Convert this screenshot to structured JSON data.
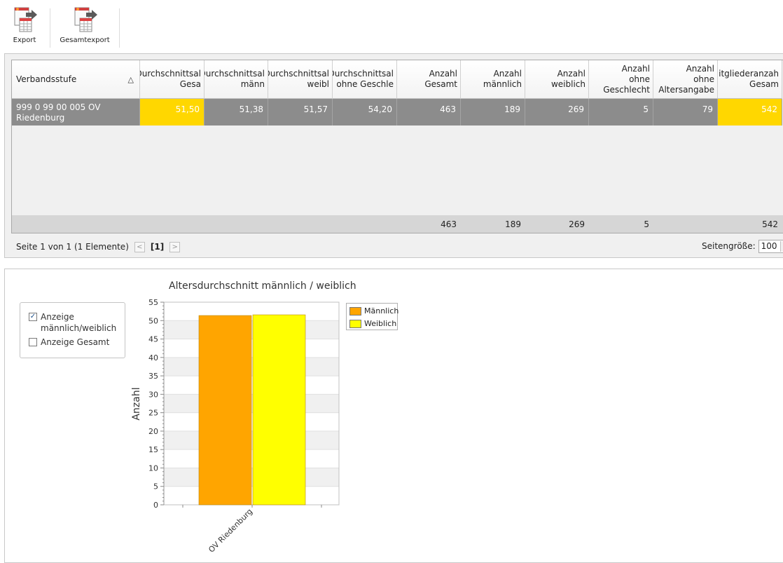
{
  "toolbar": {
    "export_label": "Export",
    "gesamtexport_label": "Gesamtexport"
  },
  "grid": {
    "columns": [
      "Verbandsstufe",
      "Durchschnittsal\nGesa",
      "Durchschnittsal\nmänn",
      "Durchschnittsal\nweibl",
      "Durchschnittsal\nohne Geschle",
      "Anzahl\nGesamt",
      "Anzahl\nmännlich",
      "Anzahl\nweiblich",
      "Anzahl\nohne\nGeschlecht",
      "Anzahl\nohne\nAltersangabe",
      "Mitgliederanzah\nGesam"
    ],
    "sort_icon": "sort-ascending-icon",
    "row": [
      "999 0 99 00 005 OV\nRiedenburg",
      "51,50",
      "51,38",
      "51,57",
      "54,20",
      "463",
      "189",
      "269",
      "5",
      "79",
      "542"
    ],
    "totals": [
      "",
      "",
      "",
      "",
      "",
      "463",
      "189",
      "269",
      "5",
      "",
      "542"
    ],
    "highlight_color": "#FFD700"
  },
  "pager": {
    "info": "Seite 1 von 1 (1 Elemente)",
    "prev_icon": "chevron-left-icon",
    "current": "[1]",
    "next_icon": "chevron-right-icon",
    "pagesize_label": "Seitengröße:",
    "pagesize_value": "100"
  },
  "options": {
    "show_mf_label": "Anzeige männlich/weiblich",
    "show_mf_checked": true,
    "show_total_label": "Anzeige Gesamt",
    "show_total_checked": false
  },
  "chart_data": {
    "type": "bar",
    "title": "Altersdurchschnitt männlich / weiblich",
    "xlabel": "",
    "ylabel": "Anzahl",
    "categories": [
      "OV Riedenburg"
    ],
    "series": [
      {
        "name": "Männlich",
        "values": [
          51.38
        ],
        "color": "#FFA500"
      },
      {
        "name": "Weiblich",
        "values": [
          51.57
        ],
        "color": "#FFFF00"
      }
    ],
    "ylim": [
      0,
      55
    ],
    "yticks": [
      0,
      5,
      10,
      15,
      20,
      25,
      30,
      35,
      40,
      45,
      50,
      55
    ],
    "grid": true,
    "legend": "top-right"
  }
}
